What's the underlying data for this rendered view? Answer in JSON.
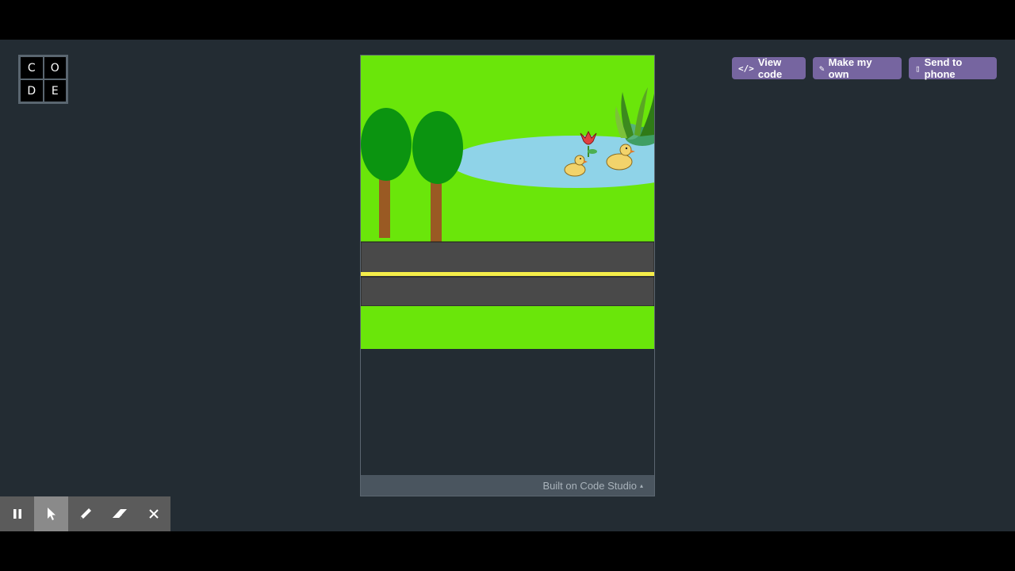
{
  "logo": {
    "letters": [
      "C",
      "O",
      "D",
      "E"
    ]
  },
  "header_buttons": [
    {
      "label": "View code",
      "icon": "code-icon",
      "icon_glyph": "</>"
    },
    {
      "label": "Make my own",
      "icon": "edit-icon",
      "icon_glyph": "✎"
    },
    {
      "label": "Send to phone",
      "icon": "phone-icon",
      "icon_glyph": "▯"
    }
  ],
  "app": {
    "footer_text": "Built on Code Studio",
    "footer_caret": "▴"
  },
  "toolbar": {
    "tools": [
      "pause-icon",
      "cursor-icon",
      "pencil-icon",
      "eraser-icon",
      "close-icon"
    ],
    "active": "cursor-icon"
  },
  "colors": {
    "accent": "#7665a0",
    "background": "#232c33",
    "grass": "#6ae60a",
    "pond": "#8fd3e8",
    "road": "#494949",
    "road_line": "#f6ee4a",
    "tree_canopy": "#0b9410",
    "tree_trunk": "#9a5a23"
  }
}
